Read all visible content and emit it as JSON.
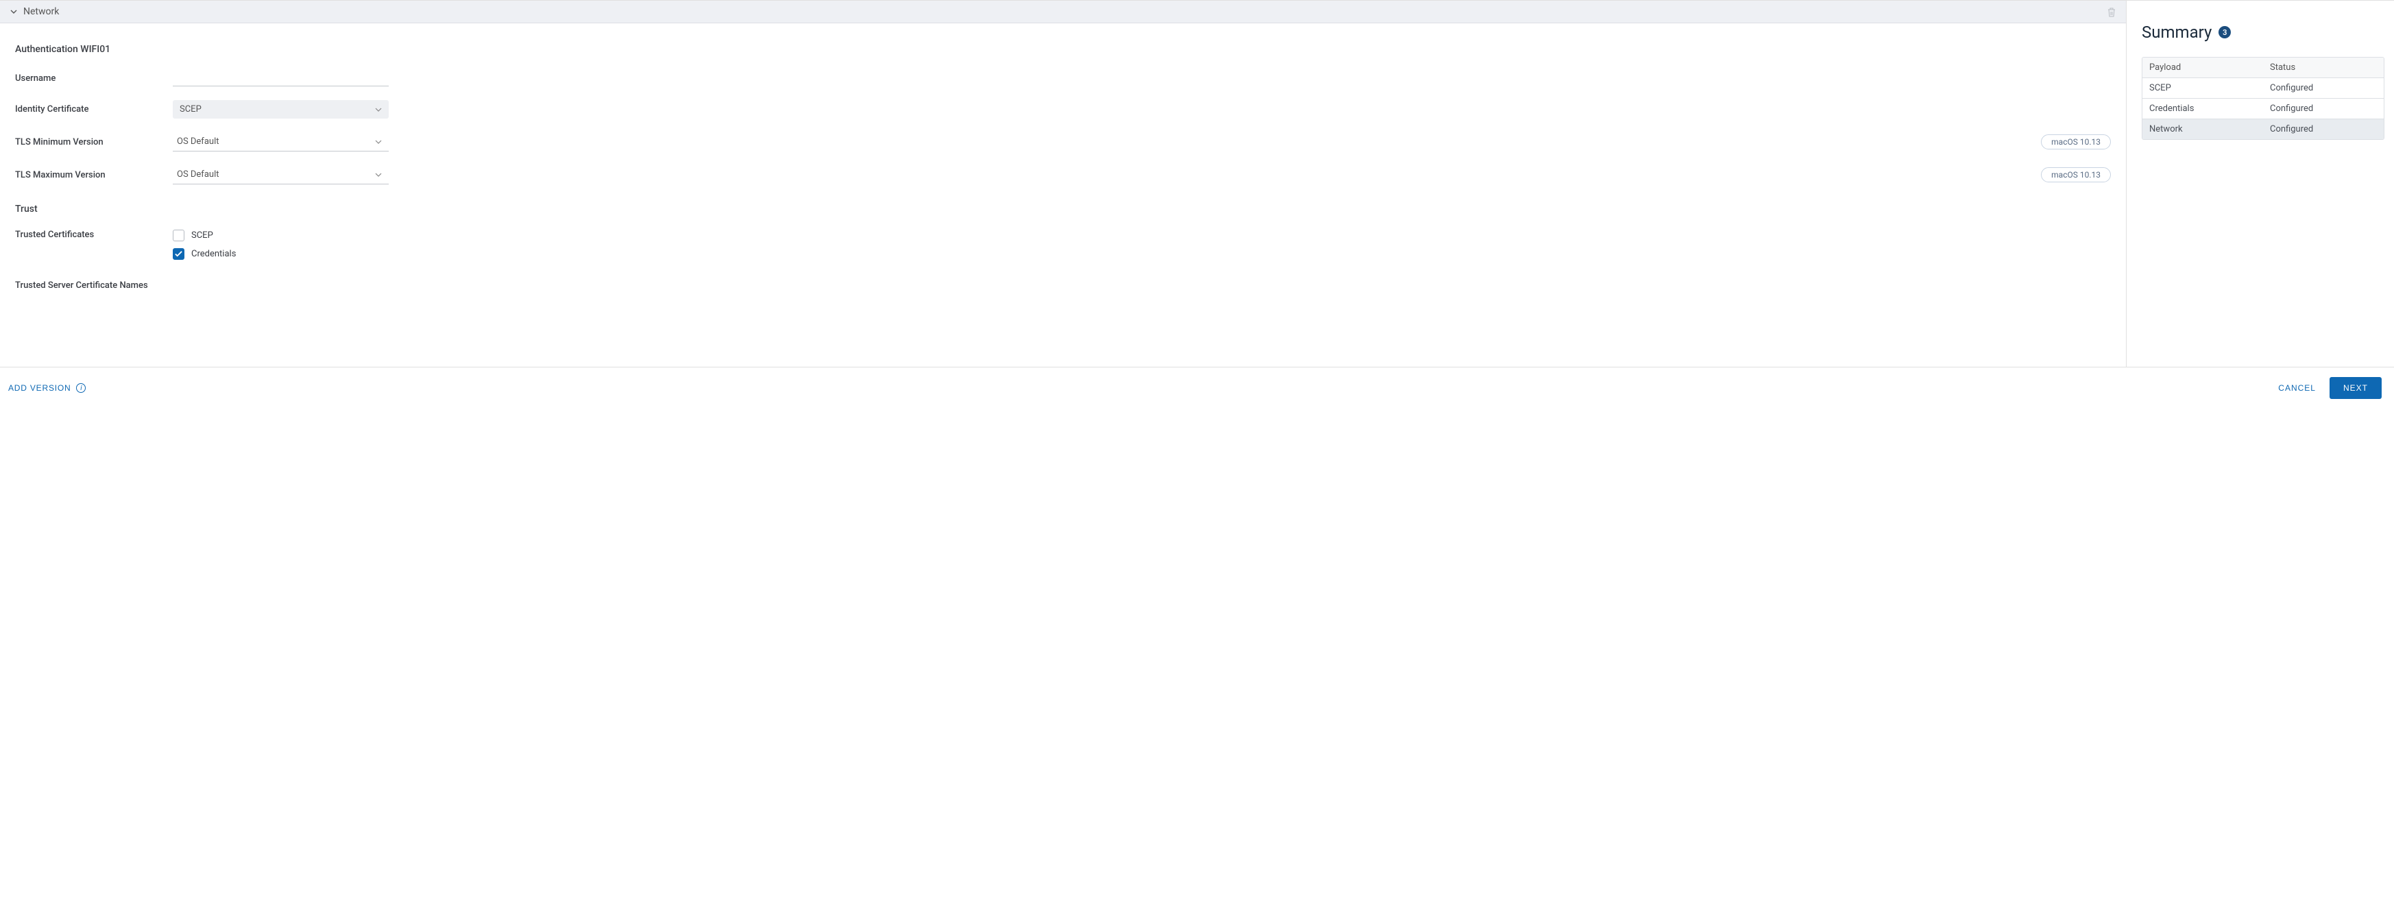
{
  "section": {
    "title": "Network"
  },
  "auth": {
    "heading": "Authentication WIFI01",
    "username_label": "Username",
    "username_value": "",
    "identity_cert_label": "Identity Certificate",
    "identity_cert_value": "SCEP",
    "tls_min_label": "TLS Minimum Version",
    "tls_min_value": "OS Default",
    "tls_min_badge": "macOS 10.13",
    "tls_max_label": "TLS Maximum Version",
    "tls_max_value": "OS Default",
    "tls_max_badge": "macOS 10.13"
  },
  "trust": {
    "heading": "Trust",
    "trusted_certs_label": "Trusted Certificates",
    "cert_options": [
      {
        "label": "SCEP",
        "checked": false
      },
      {
        "label": "Credentials",
        "checked": true
      }
    ],
    "trusted_server_names_label": "Trusted Server Certificate Names"
  },
  "summary": {
    "title": "Summary",
    "count": "3",
    "columns": {
      "payload": "Payload",
      "status": "Status"
    },
    "rows": [
      {
        "payload": "SCEP",
        "status": "Configured",
        "selected": false
      },
      {
        "payload": "Credentials",
        "status": "Configured",
        "selected": false
      },
      {
        "payload": "Network",
        "status": "Configured",
        "selected": true
      }
    ]
  },
  "footer": {
    "add_version": "ADD VERSION",
    "cancel": "CANCEL",
    "next": "NEXT"
  }
}
